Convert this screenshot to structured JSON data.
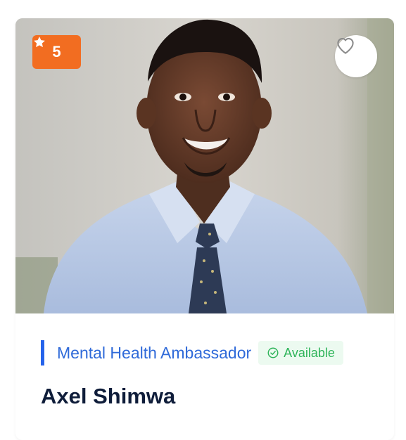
{
  "card": {
    "rating": {
      "icon": "star-icon",
      "value": "5",
      "color": "#f26d21"
    },
    "favorite": {
      "icon": "heart-outline-icon"
    },
    "photo": {
      "subject": "portrait"
    },
    "role": "Mental Health Ambassador",
    "status": {
      "icon": "check-circle-icon",
      "label": "Available",
      "color": "#2fb45a"
    },
    "name": "Axel Shimwa",
    "accent_color": "#2563eb"
  }
}
